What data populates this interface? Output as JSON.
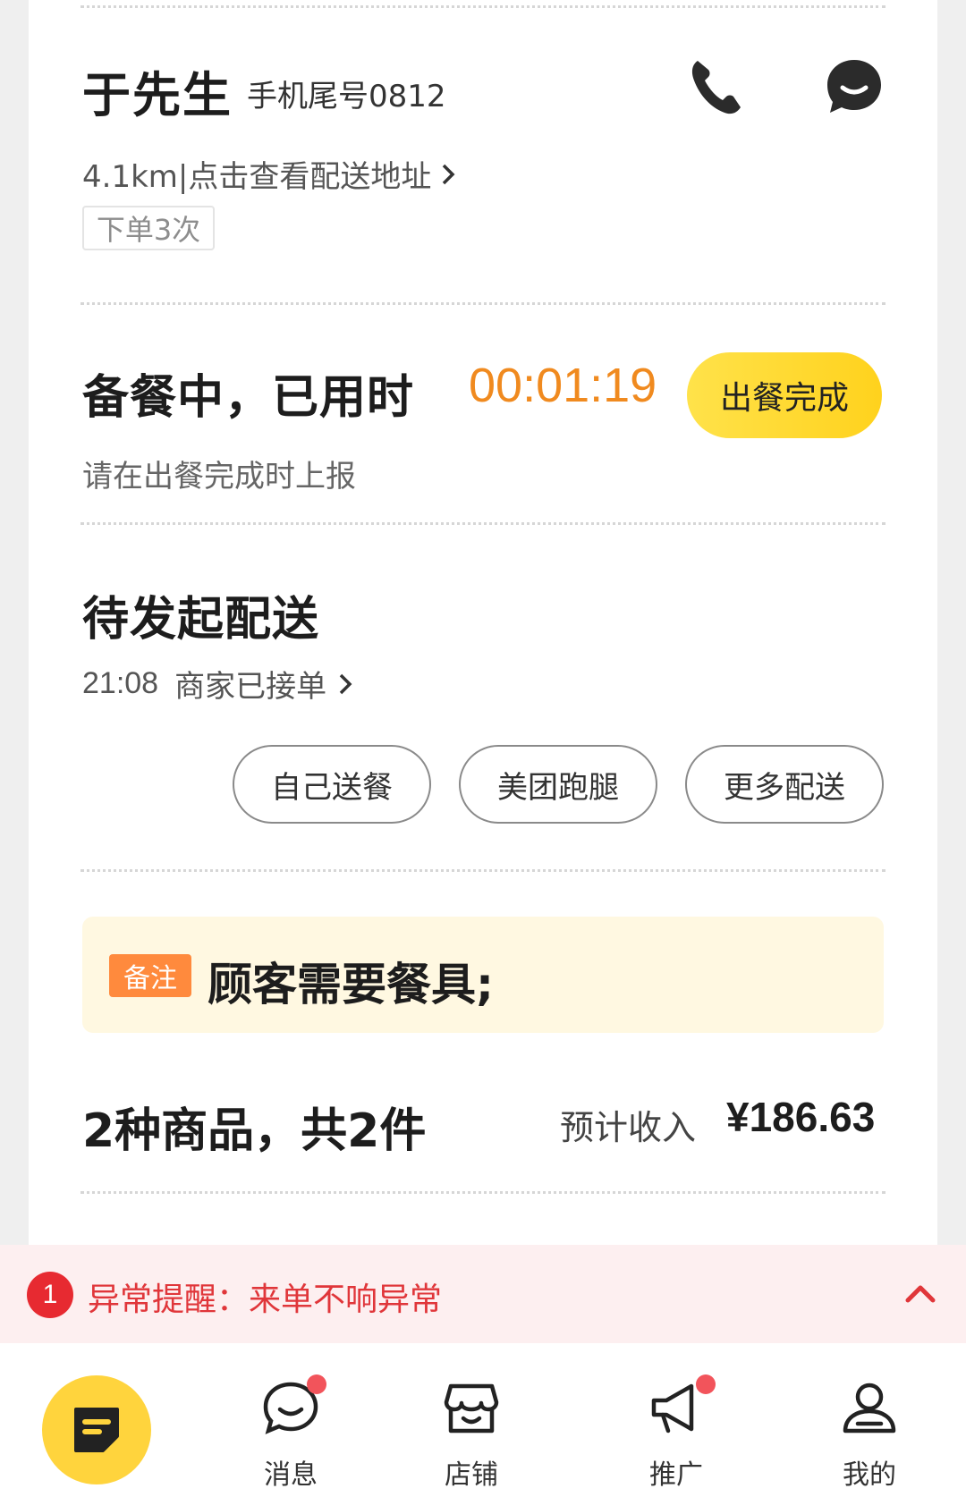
{
  "customer": {
    "name": "于先生",
    "phone_tail": "手机尾号0812",
    "address_link": "4.1km|点击查看配送地址",
    "order_count": "下单3次"
  },
  "prep": {
    "title": "备餐中，已用时",
    "timer": "00:01:19",
    "done_button": "出餐完成",
    "hint": "请在出餐完成时上报"
  },
  "delivery": {
    "title": "待发起配送",
    "status_time": "21:08",
    "status_text": "商家已接单",
    "options": [
      "自己送餐",
      "美团跑腿",
      "更多配送"
    ]
  },
  "remark": {
    "tag": "备注",
    "text": "顾客需要餐具;"
  },
  "summary": {
    "count": "2种商品，共2件",
    "income_label": "预计收入",
    "income_value": "¥186.63"
  },
  "alert": {
    "badge": "1",
    "text": "异常提醒：来单不响异常"
  },
  "tabbar": {
    "messages": "消息",
    "store": "店铺",
    "promote": "推广",
    "mine": "我的"
  },
  "colors": {
    "accent_yellow": "#ffd21d",
    "timer_orange": "#f08a1f",
    "alert_red": "#e72a31",
    "remark_bg": "#fff8e1"
  }
}
